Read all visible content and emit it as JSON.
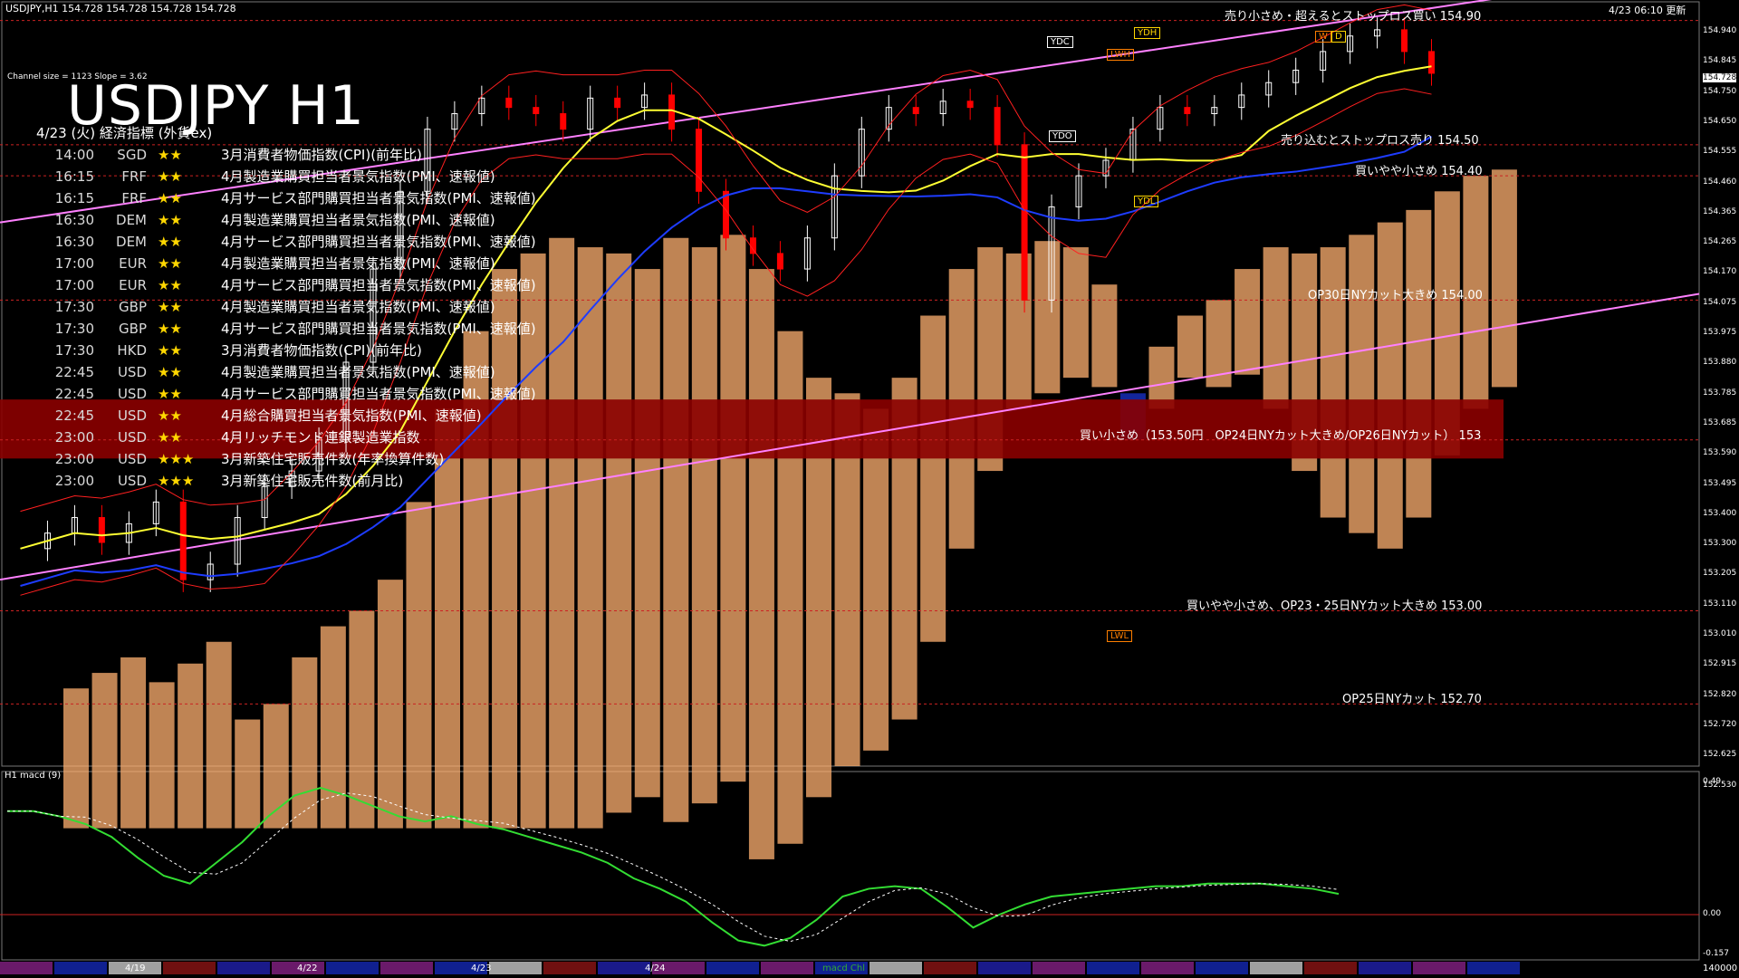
{
  "header": {
    "symbol_line": "USDJPY,H1  154.728 154.728 154.728 154.728",
    "update": "4/23 06:10 更新",
    "channel": "Channel size = 1123  Slope = 3.62"
  },
  "title": "USDJPY H1",
  "events_title": "4/23 (火) 経済指標 (外貨ex)",
  "events": [
    {
      "time": "14:00",
      "ccy": "SGD",
      "stars": "★★",
      "name": "3月消費者物価指数(CPI)(前年比)"
    },
    {
      "time": "16:15",
      "ccy": "FRF",
      "stars": "★★",
      "name": "4月製造業購買担当者景気指数(PMI、速報値)"
    },
    {
      "time": "16:15",
      "ccy": "FRF",
      "stars": "★★",
      "name": "4月サービス部門購買担当者景気指数(PMI、速報値)"
    },
    {
      "time": "16:30",
      "ccy": "DEM",
      "stars": "★★",
      "name": "4月製造業購買担当者景気指数(PMI、速報値)"
    },
    {
      "time": "16:30",
      "ccy": "DEM",
      "stars": "★★",
      "name": "4月サービス部門購買担当者景気指数(PMI、速報値)"
    },
    {
      "time": "17:00",
      "ccy": "EUR",
      "stars": "★★",
      "name": "4月製造業購買担当者景気指数(PMI、速報値)"
    },
    {
      "time": "17:00",
      "ccy": "EUR",
      "stars": "★★",
      "name": "4月サービス部門購買担当者景気指数(PMI、速報値)"
    },
    {
      "time": "17:30",
      "ccy": "GBP",
      "stars": "★★",
      "name": "4月製造業購買担当者景気指数(PMI、速報値)"
    },
    {
      "time": "17:30",
      "ccy": "GBP",
      "stars": "★★",
      "name": "4月サービス部門購買担当者景気指数(PMI、速報値)"
    },
    {
      "time": "17:30",
      "ccy": "HKD",
      "stars": "★★",
      "name": "3月消費者物価指数(CPI)(前年比)"
    },
    {
      "time": "22:45",
      "ccy": "USD",
      "stars": "★★",
      "name": "4月製造業購買担当者景気指数(PMI、速報値)"
    },
    {
      "time": "22:45",
      "ccy": "USD",
      "stars": "★★",
      "name": "4月サービス部門購買担当者景気指数(PMI、速報値)"
    },
    {
      "time": "22:45",
      "ccy": "USD",
      "stars": "★★",
      "name": "4月総合購買担当者景気指数(PMI、速報値)"
    },
    {
      "time": "23:00",
      "ccy": "USD",
      "stars": "★★",
      "name": "4月リッチモンド連銀製造業指数"
    },
    {
      "time": "23:00",
      "ccy": "USD",
      "stars": "★★★",
      "name": "3月新築住宅販売件数(年率換算件数)"
    },
    {
      "time": "23:00",
      "ccy": "USD",
      "stars": "★★★",
      "name": "3月新築住宅販売件数(前月比)"
    }
  ],
  "notes": [
    {
      "text": "売り小さめ・超えるとストップロス買い 154.90",
      "price": 154.9
    },
    {
      "text": "売り込むとストップロス売り 154.50",
      "price": 154.5
    },
    {
      "text": "買いやや小さめ 154.40",
      "price": 154.4
    },
    {
      "text": "OP30日NYカット大きめ 154.00",
      "price": 154.0
    },
    {
      "text": "買い小さめ（153.50円　OP24日NYカット大きめ/OP26日NYカット） 153",
      "price": 153.55
    },
    {
      "text": "買いやや小さめ、OP23・25日NYカット大きめ 153.00",
      "price": 153.0
    },
    {
      "text": "OP25日NYカット 152.70",
      "price": 152.7
    }
  ],
  "tags": [
    {
      "text": "YDH",
      "color": "#ffd700"
    },
    {
      "text": "YDC",
      "color": "#ffffff"
    },
    {
      "text": "LWH",
      "color": "#ff7f00"
    },
    {
      "text": "YDO",
      "color": "#ffffff"
    },
    {
      "text": "YDL",
      "color": "#ffd700"
    },
    {
      "text": "LWL",
      "color": "#ff7f00"
    },
    {
      "text": "W",
      "color": "#ff7f00"
    },
    {
      "text": "D",
      "color": "#ffd700"
    }
  ],
  "price_axis": [
    "154.940",
    "154.845",
    "154.750",
    "154.650",
    "154.555",
    "154.460",
    "154.365",
    "154.265",
    "154.170",
    "154.075",
    "153.975",
    "153.880",
    "153.785",
    "153.685",
    "153.590",
    "153.495",
    "153.400",
    "153.300",
    "153.205",
    "153.110",
    "153.010",
    "152.915",
    "152.820",
    "152.720",
    "152.625",
    "152.530"
  ],
  "current_price": "154.728",
  "macd": {
    "label": "H1  macd (9)",
    "top": "0.49",
    "zero": "0.00",
    "bottom": "-0.157"
  },
  "dates": [
    "4/19",
    "4/22",
    "4/23",
    "4/24"
  ],
  "bottom_tag": "macd Chl",
  "volume_label": "140000",
  "colors": {
    "bg": "#000000",
    "bull": "#ffffff",
    "bear": "#ff0000",
    "sma_yellow": "#ffff33",
    "sma_blue": "#1e3cff",
    "band": "#ff2020",
    "channel": "#ff80ff",
    "cloud_up": "#ffb070",
    "cloud_down": "#1830c0",
    "macd": "#33dd33",
    "signal": "#ffffff",
    "event_band": "#8b0000"
  },
  "chart_data": {
    "type": "line",
    "title": "USDJPY H1",
    "ylim": [
      152.5,
      154.96
    ],
    "series": [
      {
        "name": "USDJPY",
        "values": [
          153.2,
          153.25,
          153.3,
          153.22,
          153.28,
          153.35,
          153.1,
          153.15,
          153.3,
          153.4,
          153.45,
          153.55,
          153.8,
          154.1,
          154.35,
          154.55,
          154.6,
          154.65,
          154.62,
          154.6,
          154.55,
          154.65,
          154.62,
          154.66,
          154.55,
          154.35,
          154.2,
          154.15,
          154.1,
          154.2,
          154.4,
          154.55,
          154.62,
          154.6,
          154.64,
          154.62,
          154.5,
          154.0,
          154.3,
          154.4,
          154.45,
          154.55,
          154.62,
          154.6,
          154.62,
          154.66,
          154.7,
          154.74,
          154.8,
          154.85,
          154.87,
          154.8,
          154.73
        ]
      }
    ],
    "macd": [
      0.4,
      0.4,
      0.38,
      0.35,
      0.3,
      0.22,
      0.15,
      0.12,
      0.2,
      0.28,
      0.38,
      0.46,
      0.49,
      0.46,
      0.42,
      0.38,
      0.36,
      0.38,
      0.35,
      0.33,
      0.3,
      0.27,
      0.24,
      0.2,
      0.14,
      0.1,
      0.05,
      -0.03,
      -0.1,
      -0.12,
      -0.09,
      -0.02,
      0.07,
      0.1,
      0.11,
      0.1,
      0.03,
      -0.05,
      0.0,
      0.04,
      0.07,
      0.08,
      0.09,
      0.1,
      0.11,
      0.11,
      0.12,
      0.12,
      0.12,
      0.11,
      0.1,
      0.08
    ]
  }
}
